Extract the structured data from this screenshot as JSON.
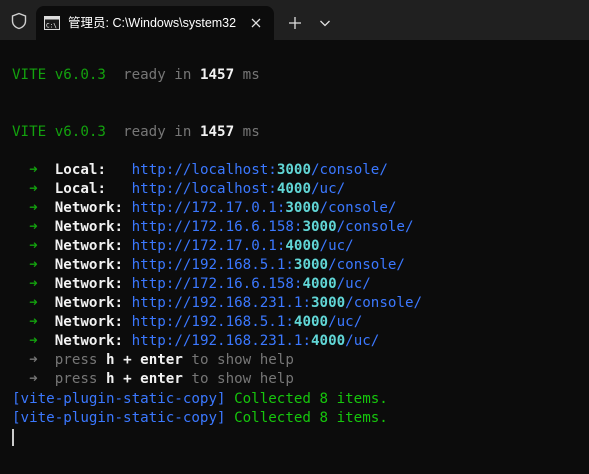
{
  "window": {
    "tab_title": "管理员: C:\\Windows\\system32",
    "icons": {
      "shield": "shield-icon",
      "terminal": "terminal-icon",
      "close": "close-icon",
      "new_tab": "plus-icon",
      "dropdown": "chevron-down-icon"
    }
  },
  "colors": {
    "background": "#0c0c0c",
    "titlebar": "#202020",
    "green": "#13a10e",
    "bright_green": "#16c60c",
    "blue": "#3b78ff",
    "dim": "#767676"
  },
  "terminal": {
    "vite1": {
      "name": "VITE",
      "version": "v6.0.3",
      "ready": "ready in",
      "time": "1457",
      "unit": "ms"
    },
    "vite2": {
      "name": "VITE",
      "version": "v6.0.3",
      "ready": "ready in",
      "time": "1457",
      "unit": "ms"
    },
    "arrow": "➜",
    "urls": [
      {
        "label": "Local:",
        "pre": "http://localhost:",
        "port": "3000",
        "path": "/console/"
      },
      {
        "label": "Local:",
        "pre": "http://localhost:",
        "port": "4000",
        "path": "/uc/"
      },
      {
        "label": "Network:",
        "pre": "http://172.17.0.1:",
        "port": "3000",
        "path": "/console/"
      },
      {
        "label": "Network:",
        "pre": "http://172.16.6.158:",
        "port": "3000",
        "path": "/console/"
      },
      {
        "label": "Network:",
        "pre": "http://172.17.0.1:",
        "port": "4000",
        "path": "/uc/"
      },
      {
        "label": "Network:",
        "pre": "http://192.168.5.1:",
        "port": "3000",
        "path": "/console/"
      },
      {
        "label": "Network:",
        "pre": "http://172.16.6.158:",
        "port": "4000",
        "path": "/uc/"
      },
      {
        "label": "Network:",
        "pre": "http://192.168.231.1:",
        "port": "3000",
        "path": "/console/"
      },
      {
        "label": "Network:",
        "pre": "http://192.168.5.1:",
        "port": "4000",
        "path": "/uc/"
      },
      {
        "label": "Network:",
        "pre": "http://192.168.231.1:",
        "port": "4000",
        "path": "/uc/"
      }
    ],
    "help": [
      {
        "press": "press",
        "key": "h + enter",
        "rest": "to show help"
      },
      {
        "press": "press",
        "key": "h + enter",
        "rest": "to show help"
      }
    ],
    "copy": [
      {
        "tag": "[vite-plugin-static-copy]",
        "msg": "Collected 8 items."
      },
      {
        "tag": "[vite-plugin-static-copy]",
        "msg": "Collected 8 items."
      }
    ]
  }
}
